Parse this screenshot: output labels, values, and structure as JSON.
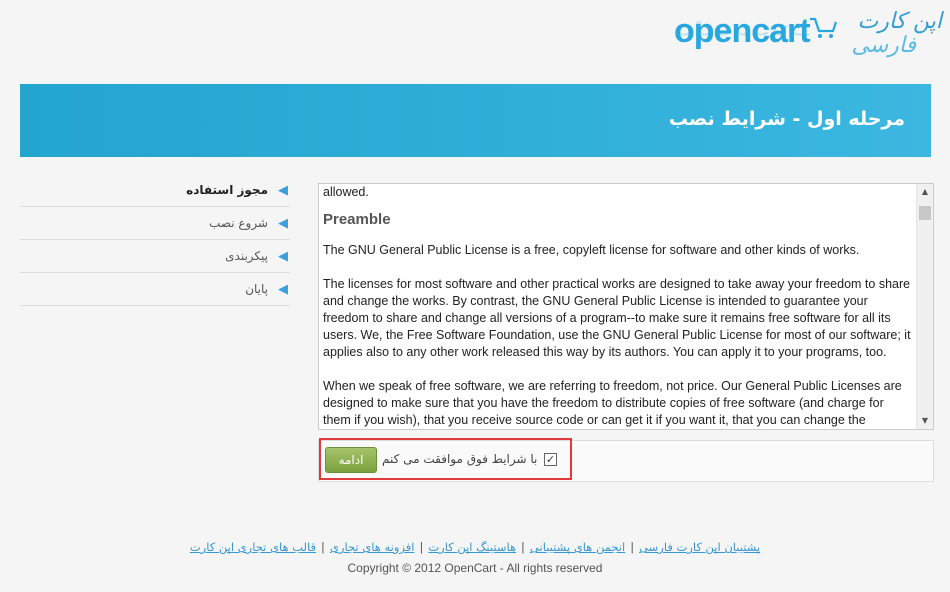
{
  "logo": {
    "brand": "opencart",
    "persian_line1": "اپن کارت",
    "persian_line2": "فارسی"
  },
  "header": {
    "title": "مرحله اول - شرایط نصب"
  },
  "sidebar": {
    "items": [
      {
        "label": "مجوز استفاده",
        "active": true
      },
      {
        "label": "شروع نصب",
        "active": false
      },
      {
        "label": "پیکربندی",
        "active": false
      },
      {
        "label": "پایان",
        "active": false
      }
    ]
  },
  "license": {
    "intro_tail": "allowed.",
    "heading": "Preamble",
    "p1": "The GNU General Public License is a free, copyleft license for software and other kinds of works.",
    "p2": "The licenses for most software and other practical works are designed to take away your freedom to share and change the works. By contrast, the GNU General Public License is intended to guarantee your freedom to share and change all versions of a program--to make sure it remains free software for all its users. We, the Free Software Foundation, use the GNU General Public License for most of our software; it applies also to any other work released this way by its authors. You can apply it to your programs, too.",
    "p3": "When we speak of free software, we are referring to freedom, not price. Our General Public Licenses are designed to make sure that you have the freedom to distribute copies of free software (and charge for them if you wish), that you receive source code or can get it if you want it, that you can change the software or use pieces of it in new free programs, and that you know you can do these things."
  },
  "agree": {
    "label": "با شرایط فوق موافقت می کنم",
    "checked": true,
    "continue_label": "ادامه"
  },
  "footer": {
    "links": [
      "پشتیبان اپن کارت فارسی",
      "انجمن های پشتیبانی",
      "هاستینگ اپن کارت",
      "افزونه های تجاری",
      "قالب های تجاری اپن کارت"
    ],
    "copyright": "Copyright © 2012 OpenCart - All rights reserved"
  },
  "colors": {
    "header_blue": "#2aa9d6",
    "button_green": "#8cb04d",
    "highlight_red": "#e03a3a",
    "link_blue": "#3597d3"
  }
}
